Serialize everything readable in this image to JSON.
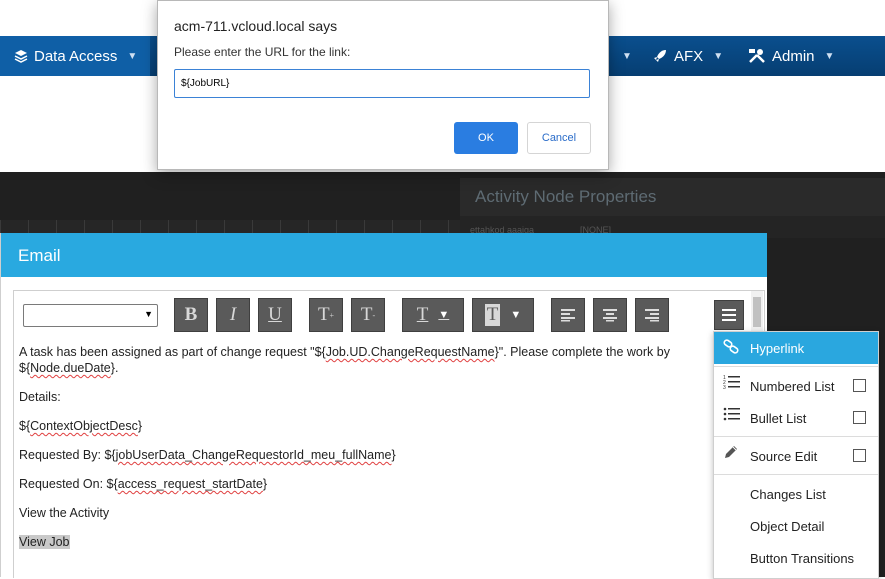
{
  "navbar": {
    "data_access_label": "Data Access",
    "afx_label": "AFX",
    "admin_label": "Admin"
  },
  "properties_panel": {
    "title": "Activity Node Properties",
    "sub_left": "ettahkod aaaiga",
    "sub_right": "[NONE]"
  },
  "email_dialog": {
    "title": "Email",
    "font_select_value": "",
    "toolbar": {
      "bold": "B",
      "italic": "I",
      "underline": "U",
      "superscript": "T",
      "subscript": "T",
      "text_color": "T",
      "background_color": "T"
    },
    "body": {
      "line1_a": "A task has been assigned as part of change request \"${",
      "line1_var": "Job.UD.ChangeRequestName",
      "line1_b": "}\". Please complete the work by",
      "line2_a": "${",
      "line2_var": "Node.dueDate",
      "line2_b": "}.",
      "details_label": "Details:",
      "context_a": "${",
      "context_var": "ContextObjectDesc",
      "context_b": "}",
      "requested_by_a": "Requested By: ${",
      "requested_by_var": "jobUserData_ChangeRequestorId_meu_fullName",
      "requested_by_b": "}",
      "requested_on_a": "Requested On: ${",
      "requested_on_var": "access_request_startDate",
      "requested_on_b": "}",
      "view_activity": "View the Activity",
      "view_job": "View Job"
    },
    "menu": {
      "hyperlink": "Hyperlink",
      "numbered_list": "Numbered List",
      "bullet_list": "Bullet List",
      "source_edit": "Source Edit",
      "changes_list": "Changes List",
      "object_detail": "Object Detail",
      "button_transitions": "Button Transitions"
    }
  },
  "alert": {
    "title": "acm-711.vcloud.local says",
    "message": "Please enter the URL for the link:",
    "input_value": "${JobURL}",
    "ok_label": "OK",
    "cancel_label": "Cancel"
  },
  "colors": {
    "navbar": "#063e72",
    "dialog_header": "#29a9e0",
    "menu_active": "#2aa7df",
    "ok_button": "#2a7de1"
  }
}
